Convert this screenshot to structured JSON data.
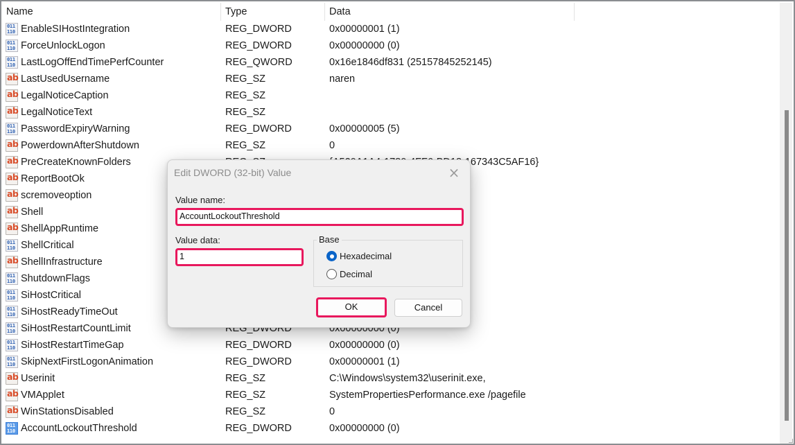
{
  "columns": {
    "name": "Name",
    "type": "Type",
    "data": "Data"
  },
  "rows": [
    {
      "icon": "binary",
      "name": "EnableSIHostIntegration",
      "type": "REG_DWORD",
      "data": "0x00000001 (1)"
    },
    {
      "icon": "binary",
      "name": "ForceUnlockLogon",
      "type": "REG_DWORD",
      "data": "0x00000000 (0)"
    },
    {
      "icon": "binary",
      "name": "LastLogOffEndTimePerfCounter",
      "type": "REG_QWORD",
      "data": "0x16e1846df831 (25157845252145)"
    },
    {
      "icon": "string",
      "name": "LastUsedUsername",
      "type": "REG_SZ",
      "data": "naren"
    },
    {
      "icon": "string",
      "name": "LegalNoticeCaption",
      "type": "REG_SZ",
      "data": ""
    },
    {
      "icon": "string",
      "name": "LegalNoticeText",
      "type": "REG_SZ",
      "data": ""
    },
    {
      "icon": "binary",
      "name": "PasswordExpiryWarning",
      "type": "REG_DWORD",
      "data": "0x00000005 (5)"
    },
    {
      "icon": "string",
      "name": "PowerdownAfterShutdown",
      "type": "REG_SZ",
      "data": "0"
    },
    {
      "icon": "string",
      "name": "PreCreateKnownFolders",
      "type": "REG_SZ",
      "data": "{A520A1A4-1780-4FF6-BD18-167343C5AF16}"
    },
    {
      "icon": "string",
      "name": "ReportBootOk",
      "type": "",
      "data": ""
    },
    {
      "icon": "string",
      "name": "scremoveoption",
      "type": "",
      "data": ""
    },
    {
      "icon": "string",
      "name": "Shell",
      "type": "",
      "data": ""
    },
    {
      "icon": "string",
      "name": "ShellAppRuntime",
      "type": "",
      "data": ""
    },
    {
      "icon": "binary",
      "name": "ShellCritical",
      "type": "",
      "data": ""
    },
    {
      "icon": "string",
      "name": "ShellInfrastructure",
      "type": "",
      "data": ""
    },
    {
      "icon": "binary",
      "name": "ShutdownFlags",
      "type": "",
      "data": ""
    },
    {
      "icon": "binary",
      "name": "SiHostCritical",
      "type": "",
      "data": ""
    },
    {
      "icon": "binary",
      "name": "SiHostReadyTimeOut",
      "type": "",
      "data": ""
    },
    {
      "icon": "binary",
      "name": "SiHostRestartCountLimit",
      "type": "REG_DWORD",
      "data": "0x00000000 (0)"
    },
    {
      "icon": "binary",
      "name": "SiHostRestartTimeGap",
      "type": "REG_DWORD",
      "data": "0x00000000 (0)"
    },
    {
      "icon": "binary",
      "name": "SkipNextFirstLogonAnimation",
      "type": "REG_DWORD",
      "data": "0x00000001 (1)"
    },
    {
      "icon": "string",
      "name": "Userinit",
      "type": "REG_SZ",
      "data": "C:\\Windows\\system32\\userinit.exe,"
    },
    {
      "icon": "string",
      "name": "VMApplet",
      "type": "REG_SZ",
      "data": "SystemPropertiesPerformance.exe /pagefile"
    },
    {
      "icon": "string",
      "name": "WinStationsDisabled",
      "type": "REG_SZ",
      "data": "0"
    },
    {
      "icon": "binary-selected",
      "name": "AccountLockoutThreshold",
      "type": "REG_DWORD",
      "data": "0x00000000 (0)"
    }
  ],
  "dialog": {
    "title": "Edit DWORD (32-bit) Value",
    "close_icon": "×",
    "value_name_label": "Value name:",
    "value_name": "AccountLockoutThreshold",
    "value_data_label": "Value data:",
    "value_data": "1",
    "base_label": "Base",
    "base_options": [
      {
        "label": "Hexadecimal",
        "selected": true
      },
      {
        "label": "Decimal",
        "selected": false
      }
    ],
    "ok_label": "OK",
    "cancel_label": "Cancel"
  },
  "highlight_color": "#e8185d",
  "accent_color": "#0a64c8"
}
